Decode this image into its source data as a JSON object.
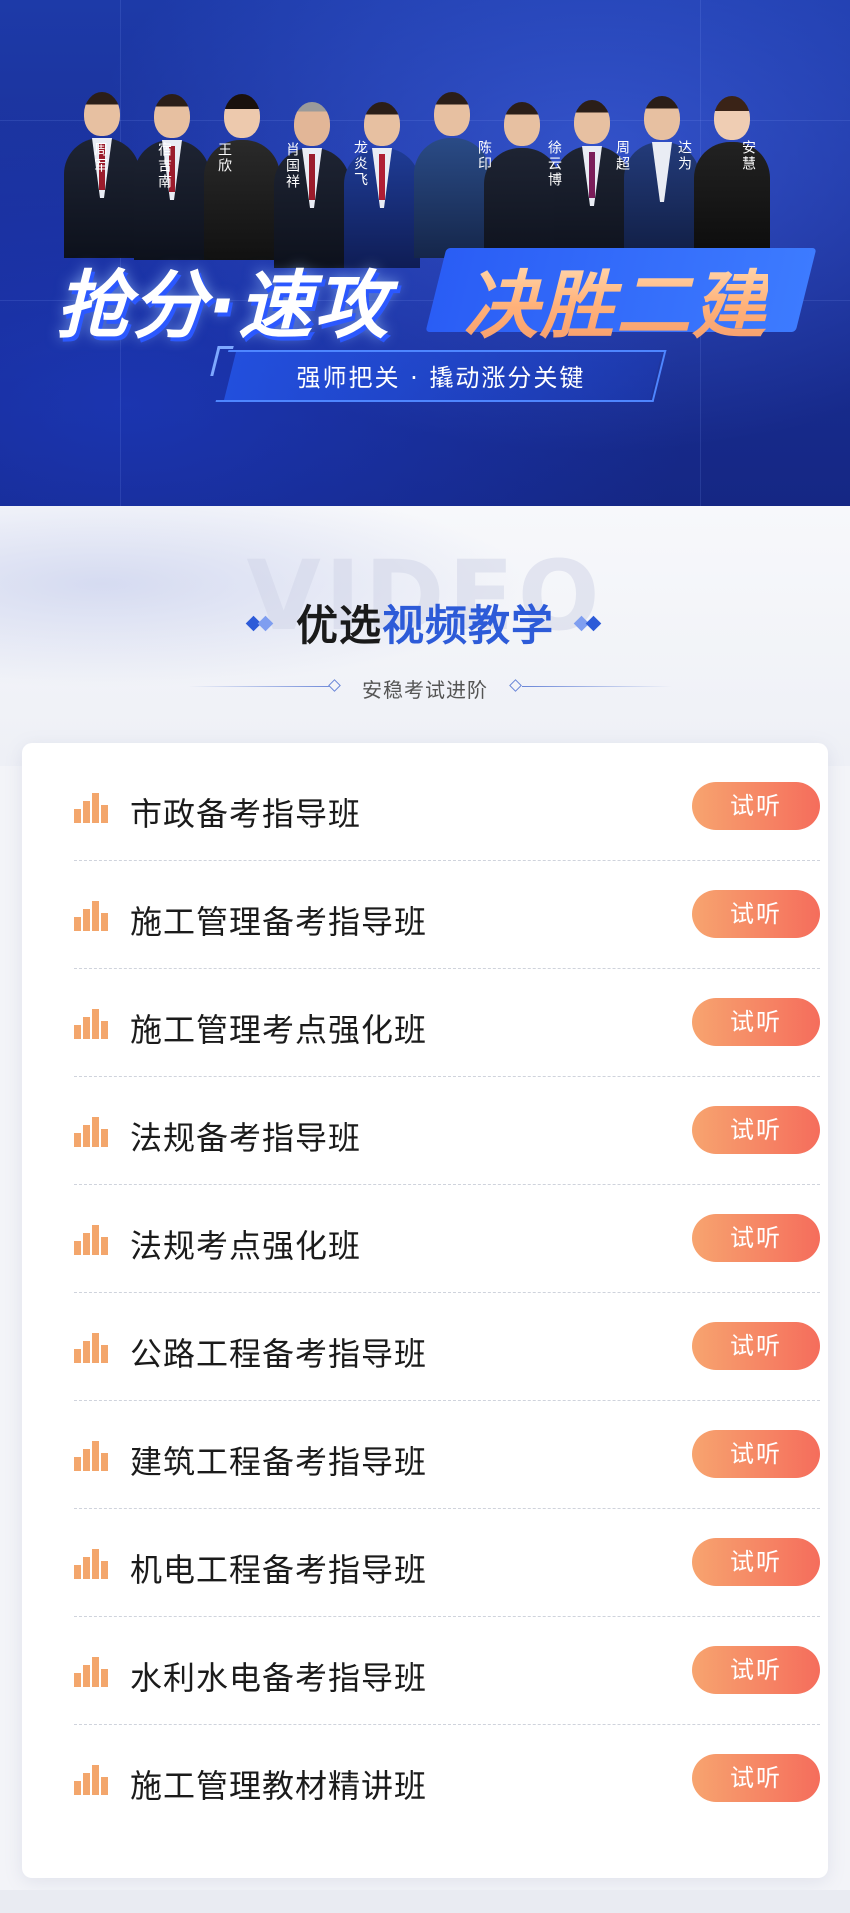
{
  "hero": {
    "teachers": [
      "周军",
      "宿吉南",
      "王欣",
      "肖国祥",
      "龙炎飞",
      "陈印",
      "徐云博",
      "周超",
      "达为",
      "安慧"
    ],
    "slogan_left": "抢分·速攻",
    "slogan_right": "决胜二建",
    "subtitle": "强师把关 · 撬动涨分关键"
  },
  "section": {
    "bg_word": "VIDEO",
    "title_plain": "优选",
    "title_accent": "视频教学",
    "subtitle": "安稳考试进阶"
  },
  "courses": [
    {
      "title": "市政备考指导班",
      "button": "试听"
    },
    {
      "title": "施工管理备考指导班",
      "button": "试听"
    },
    {
      "title": "施工管理考点强化班",
      "button": "试听"
    },
    {
      "title": "法规备考指导班",
      "button": "试听"
    },
    {
      "title": "法规考点强化班",
      "button": "试听"
    },
    {
      "title": "公路工程备考指导班",
      "button": "试听"
    },
    {
      "title": "建筑工程备考指导班",
      "button": "试听"
    },
    {
      "title": "机电工程备考指导班",
      "button": "试听"
    },
    {
      "title": "水利水电备考指导班",
      "button": "试听"
    },
    {
      "title": "施工管理教材精讲班",
      "button": "试听"
    }
  ],
  "colors": {
    "hero_blue": "#1a2f97",
    "accent_blue": "#2d5bd8",
    "button_start": "#f7a46f",
    "button_end": "#f56d5c",
    "bar_icon": "#f3a66c"
  },
  "icons": {
    "row_icon": "signal-bars-icon",
    "title_decor": "double-diamond-icon"
  }
}
